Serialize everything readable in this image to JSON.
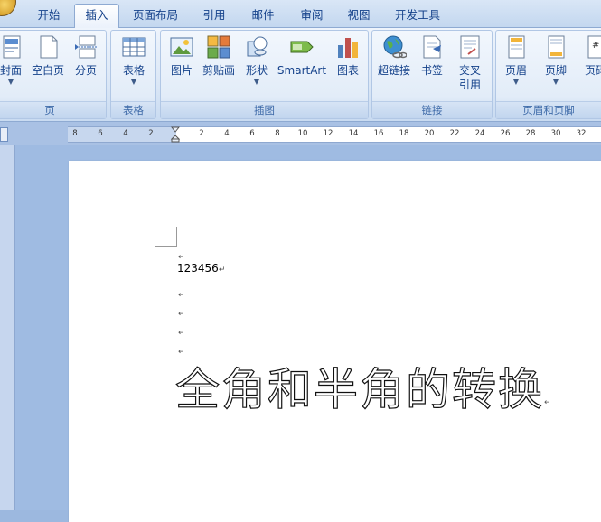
{
  "tabs": [
    {
      "label": "开始"
    },
    {
      "label": "插入",
      "active": true
    },
    {
      "label": "页面布局"
    },
    {
      "label": "引用"
    },
    {
      "label": "邮件"
    },
    {
      "label": "审阅"
    },
    {
      "label": "视图"
    },
    {
      "label": "开发工具"
    }
  ],
  "ribbon": {
    "groups": {
      "pages": {
        "label": "页",
        "buttons": {
          "cover": "封面",
          "blank": "空白页",
          "break": "分页"
        }
      },
      "tables": {
        "label": "表格",
        "buttons": {
          "table": "表格"
        }
      },
      "illustrations": {
        "label": "插图",
        "buttons": {
          "picture": "图片",
          "clipart": "剪贴画",
          "shapes": "形状",
          "smartart": "SmartArt",
          "chart": "图表"
        }
      },
      "links": {
        "label": "链接",
        "buttons": {
          "hyperlink": "超链接",
          "bookmark": "书签",
          "crossref_line1": "交叉",
          "crossref_line2": "引用"
        }
      },
      "header_footer": {
        "label": "页眉和页脚",
        "buttons": {
          "header": "页眉",
          "footer": "页脚",
          "pagenum": "页码"
        }
      }
    }
  },
  "ruler": {
    "labels": [
      "8",
      "6",
      "4",
      "2",
      "2",
      "4",
      "6",
      "8",
      "10",
      "12",
      "14",
      "16",
      "18",
      "20",
      "22",
      "24",
      "26",
      "28",
      "30",
      "32"
    ]
  },
  "document": {
    "paragraph_mark": "↵",
    "line1": "123456",
    "big_text": "全角和半角的转换"
  },
  "colors": {
    "accent": "#15428b",
    "ribbon_bg": "#dbe7f6",
    "workspace_bg": "#9fbbe2"
  }
}
